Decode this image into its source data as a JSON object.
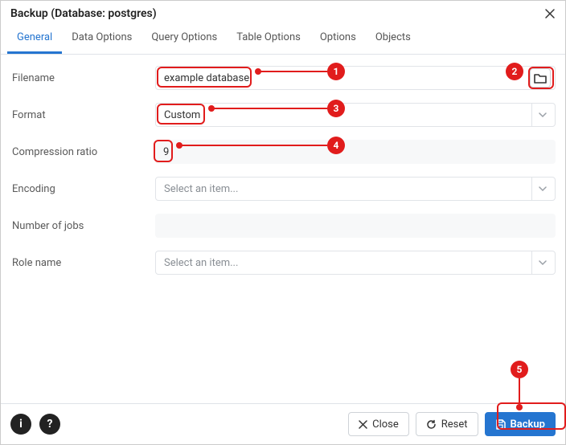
{
  "dialog": {
    "title": "Backup (Database: postgres)"
  },
  "tabs": {
    "general": "General",
    "data_options": "Data Options",
    "query_options": "Query Options",
    "table_options": "Table Options",
    "options": "Options",
    "objects": "Objects"
  },
  "form": {
    "filename_label": "Filename",
    "filename_value": "example database",
    "format_label": "Format",
    "format_value": "Custom",
    "compression_label": "Compression ratio",
    "compression_value": "9",
    "encoding_label": "Encoding",
    "encoding_placeholder": "Select an item...",
    "jobs_label": "Number of jobs",
    "jobs_value": "",
    "role_label": "Role name",
    "role_placeholder": "Select an item..."
  },
  "footer": {
    "close": "Close",
    "reset": "Reset",
    "backup": "Backup"
  },
  "annotations": {
    "a1": "1",
    "a2": "2",
    "a3": "3",
    "a4": "4",
    "a5": "5"
  }
}
